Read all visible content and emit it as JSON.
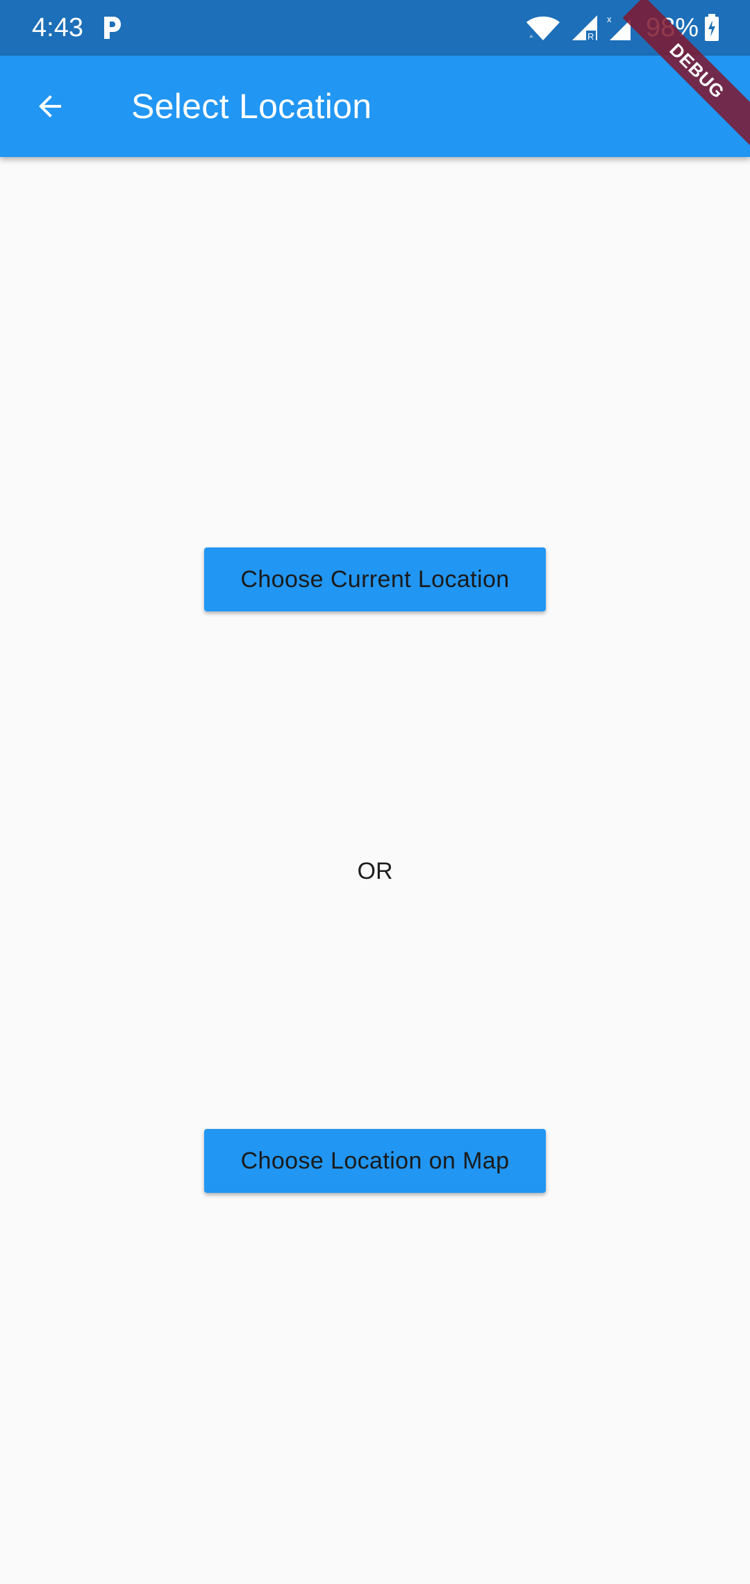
{
  "status_bar": {
    "time": "4:43",
    "notification_icon": "parking-p-icon",
    "wifi_icon": "wifi-icon",
    "signal_icons": [
      "signal-roaming-icon",
      "signal-no-data-icon"
    ],
    "battery_percent": "98%",
    "battery_icon": "battery-charging-icon",
    "background_color": "#1c6fb8"
  },
  "app_bar": {
    "back_icon": "arrow-left-icon",
    "title": "Select Location",
    "background_color": "#2196f3"
  },
  "debug_banner": {
    "label": "DEBUG"
  },
  "main": {
    "current_location_button": "Choose Current Location",
    "separator": "OR",
    "map_location_button": "Choose Location on Map",
    "button_color": "#2196f3"
  }
}
